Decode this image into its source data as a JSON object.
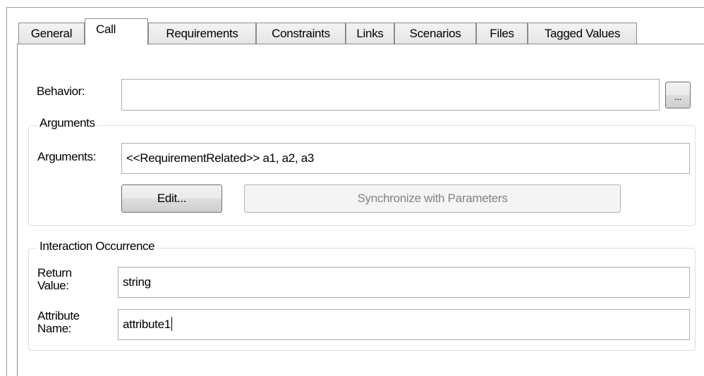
{
  "tabs": [
    {
      "label": "General",
      "active": false
    },
    {
      "label": "Call",
      "active": true
    },
    {
      "label": "Requirements",
      "active": false
    },
    {
      "label": "Constraints",
      "active": false
    },
    {
      "label": "Links",
      "active": false
    },
    {
      "label": "Scenarios",
      "active": false
    },
    {
      "label": "Files",
      "active": false
    },
    {
      "label": "Tagged Values",
      "active": false
    }
  ],
  "behavior": {
    "label": "Behavior:",
    "value": "",
    "browse_label": "..."
  },
  "arguments_group": {
    "caption": "Arguments",
    "label": "Arguments:",
    "value": "<<RequirementRelated>> a1, a2, a3",
    "edit_label": "Edit...",
    "sync_label": "Synchronize with Parameters"
  },
  "interaction_group": {
    "caption": "Interaction Occurrence",
    "return_label": "Return Value:",
    "return_value": "string",
    "attribute_label": "Attribute Name:",
    "attribute_value": "attribute1"
  },
  "colors": {
    "border": "#898c95",
    "group_border": "#d5dfe5",
    "disabled_text": "#838383"
  }
}
